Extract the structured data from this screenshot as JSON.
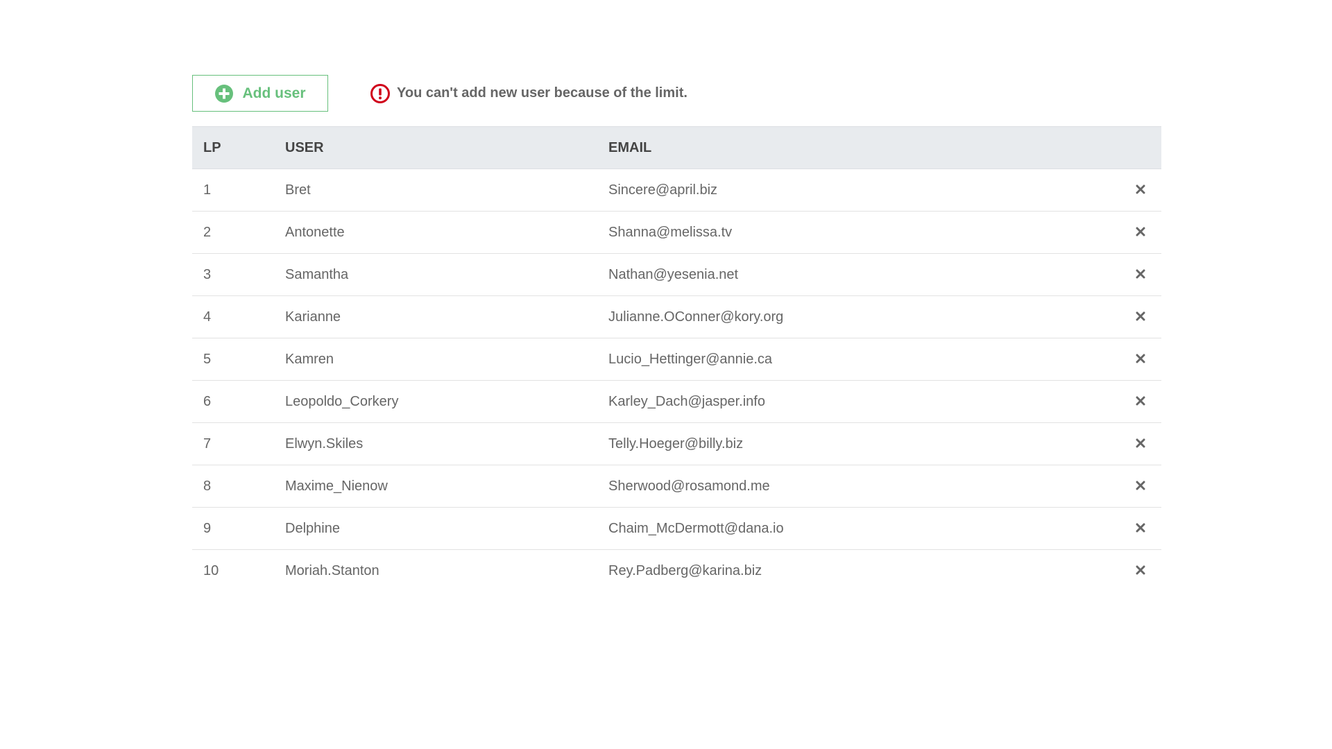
{
  "toolbar": {
    "add_button_label": "Add user",
    "warning_text": "You can't add new user because of the limit."
  },
  "colors": {
    "accent_green": "#67c07c",
    "warning_red": "#d0021b",
    "header_bg": "#e8ebee"
  },
  "table": {
    "headers": {
      "lp": "LP",
      "user": "USER",
      "email": "EMAIL"
    },
    "rows": [
      {
        "lp": "1",
        "user": "Bret",
        "email": "Sincere@april.biz"
      },
      {
        "lp": "2",
        "user": "Antonette",
        "email": "Shanna@melissa.tv"
      },
      {
        "lp": "3",
        "user": "Samantha",
        "email": "Nathan@yesenia.net"
      },
      {
        "lp": "4",
        "user": "Karianne",
        "email": "Julianne.OConner@kory.org"
      },
      {
        "lp": "5",
        "user": "Kamren",
        "email": "Lucio_Hettinger@annie.ca"
      },
      {
        "lp": "6",
        "user": "Leopoldo_Corkery",
        "email": "Karley_Dach@jasper.info"
      },
      {
        "lp": "7",
        "user": "Elwyn.Skiles",
        "email": "Telly.Hoeger@billy.biz"
      },
      {
        "lp": "8",
        "user": "Maxime_Nienow",
        "email": "Sherwood@rosamond.me"
      },
      {
        "lp": "9",
        "user": "Delphine",
        "email": "Chaim_McDermott@dana.io"
      },
      {
        "lp": "10",
        "user": "Moriah.Stanton",
        "email": "Rey.Padberg@karina.biz"
      }
    ]
  },
  "icons": {
    "add": "plus-circle-icon",
    "warning": "exclamation-circle-icon",
    "delete": "close-icon"
  }
}
